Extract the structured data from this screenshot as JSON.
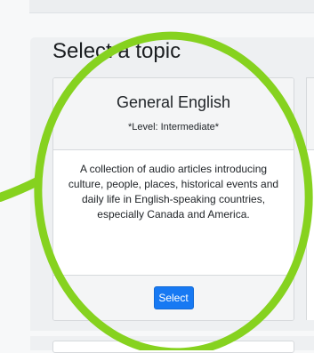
{
  "page": {
    "title": "Select a topic"
  },
  "topic_card": {
    "title": "General English",
    "level": "*Level: Intermediate*",
    "description": "A collection of audio articles introducing culture, people, places, historical events and daily life in English-speaking countries, especially Canada and America.",
    "select_label": "Select"
  },
  "annotation": {
    "color": "#86d21f"
  },
  "colors": {
    "primary_button": "#1779f3",
    "highlight": "#86d21f"
  }
}
